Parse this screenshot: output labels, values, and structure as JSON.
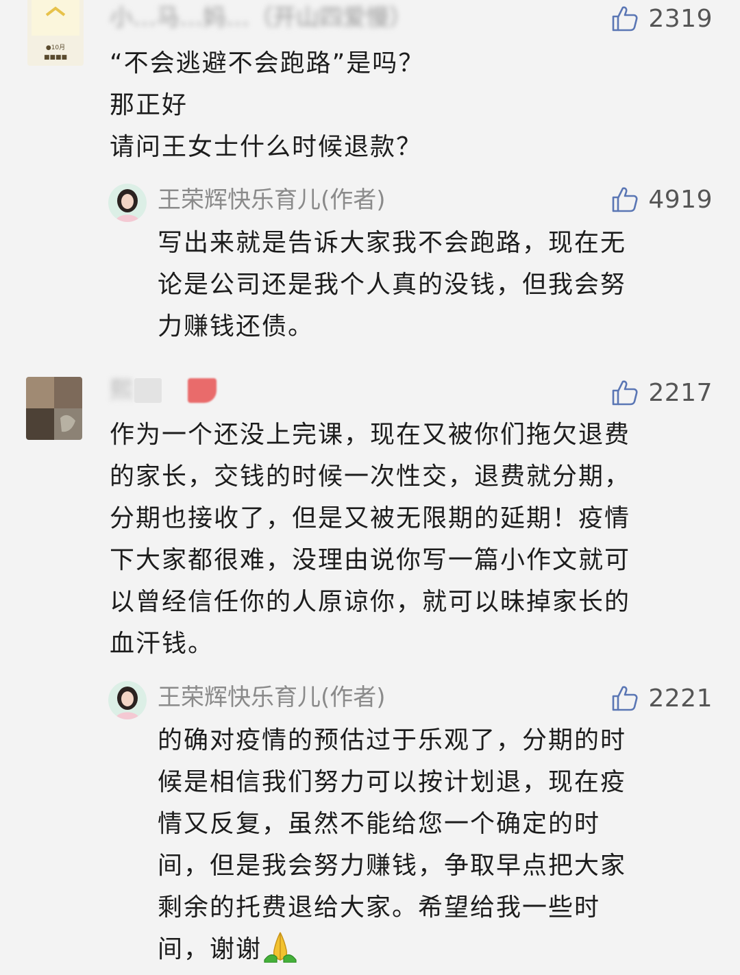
{
  "comments": [
    {
      "username": "小…马…妈…（开山四爱慢）",
      "likes": "2319",
      "lines": [
        "“不会逃避不会跑路”是吗？",
        "那正好",
        "请问王女士什么时候退款？"
      ],
      "reply": {
        "username": "王荣辉快乐育儿(作者)",
        "likes": "4919",
        "lines": [
          "写出来就是告诉大家我不会跑路，现在无",
          "论是公司还是我个人真的没钱，但我会努",
          "力赚钱还债。"
        ]
      }
    },
    {
      "username": "熙",
      "likes": "2217",
      "lines": [
        "作为一个还没上完课，现在又被你们拖欠退费",
        "的家长，交钱的时候一次性交，退费就分期，",
        "分期也接收了，但是又被无限期的延期！疫情",
        "下大家都很难，没理由说你写一篇小作文就可",
        "以曾经信任你的人原谅你，就可以昧掉家长的",
        "血汗钱。"
      ],
      "reply": {
        "username": "王荣辉快乐育儿(作者)",
        "likes": "2221",
        "lines": [
          "的确对疫情的预估过于乐观了，分期的时",
          "候是相信我们努力可以按计划退，现在疫",
          "情又反复，虽然不能给您一个确定的时",
          "间，但是我会努力赚钱，争取早点把大家",
          "剩余的托费退给大家。希望给我一些时",
          "间，谢谢"
        ]
      }
    }
  ],
  "icons": {
    "like": "thumbs-up-icon",
    "emoji": "folded-hands-emoji"
  },
  "colors": {
    "background": "#f3f3f3",
    "text": "#1c1c1c",
    "username": "#8a8a8a",
    "like_count": "#555555",
    "emoji_yellow": "#f2c230",
    "emoji_green": "#45b03a"
  }
}
